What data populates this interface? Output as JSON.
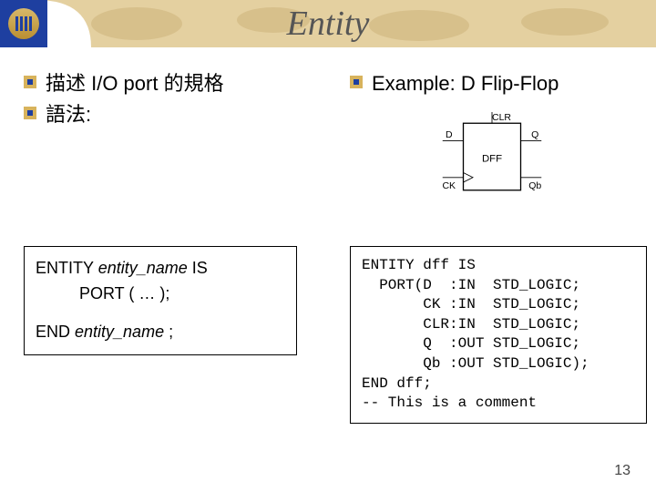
{
  "title": "Entity",
  "bullets": {
    "left": [
      "描述 I/O port 的規格",
      "語法:"
    ],
    "right": [
      "Example: D Flip-Flop"
    ]
  },
  "syntax": {
    "line1_prefix": "ENTITY ",
    "line1_em": "entity_name",
    "line1_suffix": " IS",
    "line2": "PORT ( … );",
    "end_prefix": "END ",
    "end_em": "entity_name",
    "end_suffix": " ;"
  },
  "code_block": "ENTITY dff IS\n  PORT(D  :IN  STD_LOGIC;\n       CK :IN  STD_LOGIC;\n       CLR:IN  STD_LOGIC;\n       Q  :OUT STD_LOGIC;\n       Qb :OUT STD_LOGIC);\nEND dff;\n-- This is a comment",
  "diagram": {
    "block_label": "DFF",
    "pins": {
      "D": "D",
      "Q": "Q",
      "CK": "CK",
      "Qb": "Qb",
      "CLR": "CLR"
    }
  },
  "page_number": "13"
}
